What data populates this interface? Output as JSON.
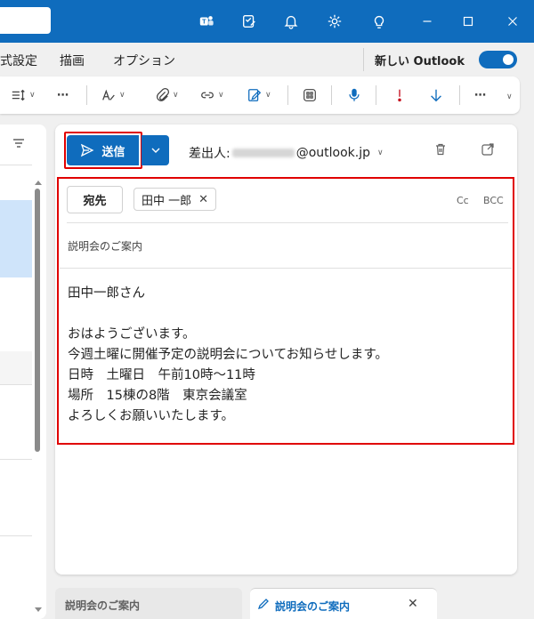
{
  "titlebar": {
    "icons": [
      "teams-icon",
      "todo-icon",
      "bell-icon",
      "gear-icon",
      "lightbulb-icon",
      "minimize-icon",
      "maximize-icon",
      "close-icon"
    ]
  },
  "menu": {
    "items": [
      "式設定",
      "描画",
      "オプション"
    ],
    "new_outlook_label": "新しい Outlook",
    "new_outlook_toggle": true
  },
  "ribbon": {
    "more_label": "⋯"
  },
  "compose": {
    "send_label": "送信",
    "from_prefix": "差出人:",
    "from_domain": "@outlook.jp",
    "to_button": "宛先",
    "recipient": "田中 一郎",
    "cc_label": "Cc",
    "bcc_label": "BCC",
    "subject": "説明会のご案内",
    "body": "田中一郎さん\n\nおはようございます。\n今週土曜に開催予定の説明会についてお知らせします。\n日時　土曜日　午前10時～11時\n場所　15棟の8階　東京会議室\nよろしくお願いいたします。"
  },
  "tabs": [
    {
      "label": "説明会のご案内",
      "active": false
    },
    {
      "label": "説明会のご案内",
      "active": true
    }
  ],
  "colors": {
    "accent": "#0f6cbd",
    "highlight": "#e00000",
    "selection": "#cfe4fa"
  }
}
